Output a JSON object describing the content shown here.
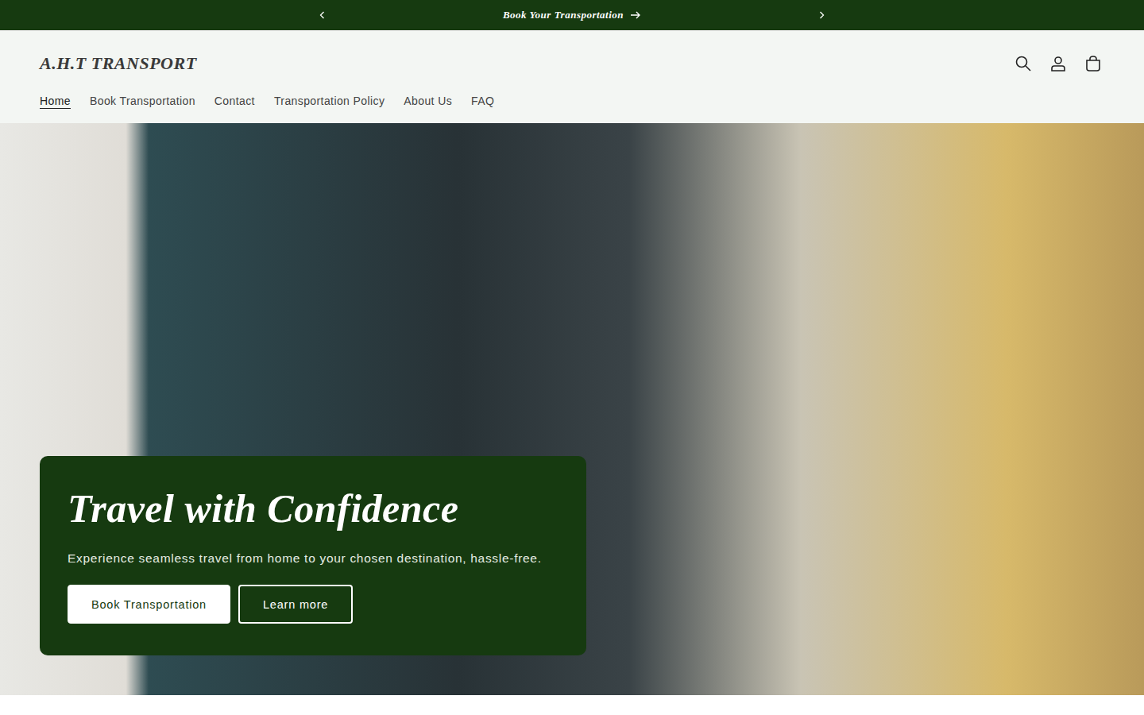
{
  "announcement": {
    "text": "Book Your Transportation"
  },
  "header": {
    "logo": "A.H.T TRANSPORT"
  },
  "nav": [
    {
      "label": "Home",
      "selected": true
    },
    {
      "label": "Book Transportation",
      "selected": false
    },
    {
      "label": "Contact",
      "selected": false
    },
    {
      "label": "Transportation Policy",
      "selected": false
    },
    {
      "label": "About Us",
      "selected": false
    },
    {
      "label": "FAQ",
      "selected": false
    }
  ],
  "hero": {
    "title": "Travel with Confidence",
    "subtitle": "Experience seamless travel from home to your chosen destination, hassle-free.",
    "buttons": [
      {
        "label": "Book Transportation",
        "kind": "solid"
      },
      {
        "label": "Learn more",
        "kind": "outline"
      }
    ]
  }
}
